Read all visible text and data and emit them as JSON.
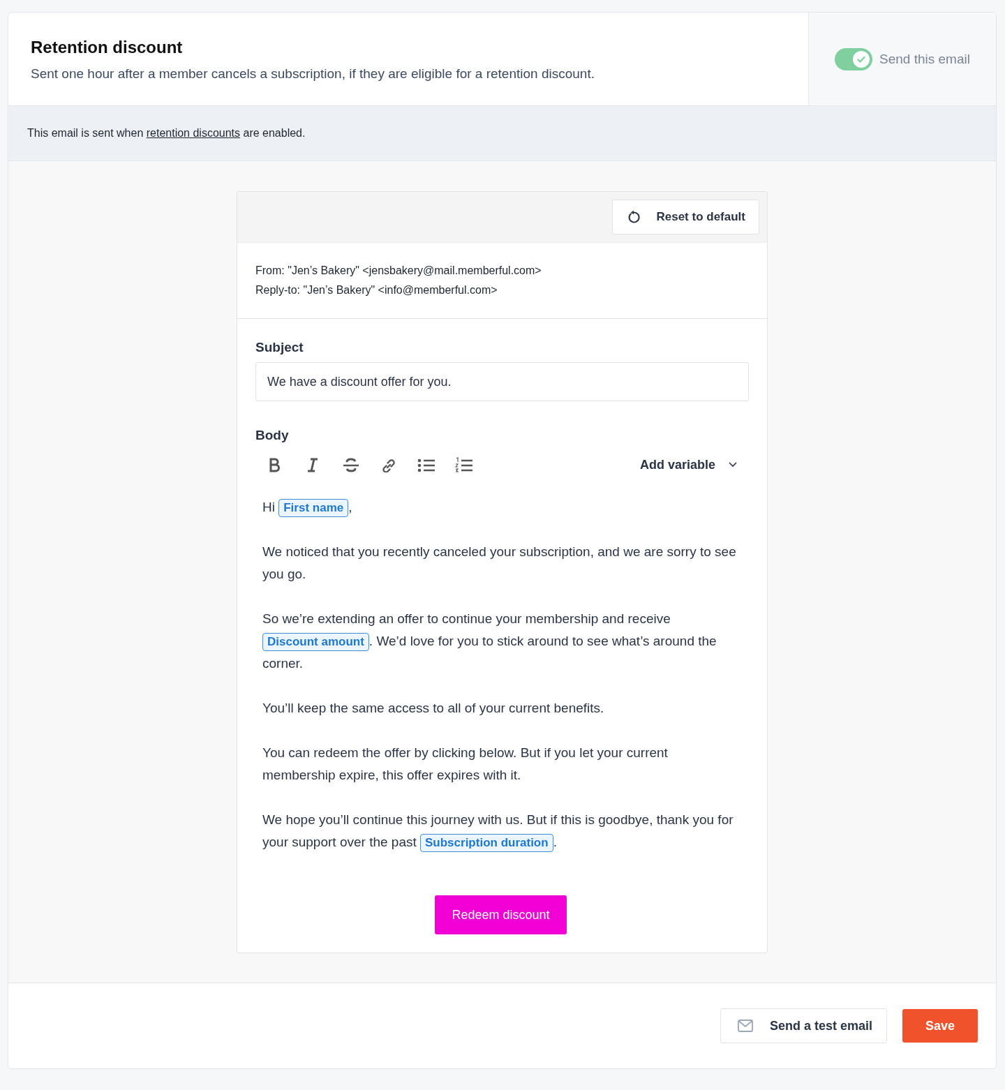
{
  "header": {
    "title": "Retention discount",
    "description": "Sent one hour after a member cancels a subscription, if they are eligible for a retention discount."
  },
  "send_toggle": {
    "on": true,
    "label": "Send this email"
  },
  "notice": [
    {
      "kind": "text",
      "text": "This email is sent when "
    },
    {
      "kind": "link",
      "text": "retention discounts"
    },
    {
      "kind": "text",
      "text": " are enabled."
    }
  ],
  "editor": {
    "reset_button": "Reset to default",
    "from": "From: \"Jen’s Bakery\" <jensbakery@mail.memberful.com>",
    "reply_to": "Reply-to: \"Jen’s Bakery\" <info@memberful.com>",
    "subject_label": "Subject",
    "subject_value": "We have a discount offer for you.",
    "body_label": "Body",
    "add_variable": "Add variable",
    "body": [
      [
        {
          "kind": "text",
          "text": "Hi "
        },
        {
          "kind": "variable",
          "text": "First name"
        },
        {
          "kind": "text",
          "text": ","
        }
      ],
      [
        {
          "kind": "text",
          "text": "We noticed that you recently canceled your subscription, and we are sorry to see you go."
        }
      ],
      [
        {
          "kind": "text",
          "text": "So we’re extending an offer to continue your membership and receive "
        },
        {
          "kind": "variable",
          "text": "Discount amount"
        },
        {
          "kind": "text",
          "text": ". We’d love for you to stick around to see what’s around the corner."
        }
      ],
      [
        {
          "kind": "text",
          "text": "You’ll keep the same access to all of your current benefits."
        }
      ],
      [
        {
          "kind": "text",
          "text": "You can redeem the offer by clicking below. But if you let your current membership expire, this offer expires with it."
        }
      ],
      [
        {
          "kind": "text",
          "text": "We hope you’ll continue this journey with us. But if this is goodbye, thank you for your support over the past "
        },
        {
          "kind": "variable",
          "text": "Subscription duration"
        },
        {
          "kind": "text",
          "text": "."
        }
      ]
    ],
    "cta_button": "Redeem discount"
  },
  "footer": {
    "test_button": "Send a test email",
    "save_button": "Save"
  }
}
